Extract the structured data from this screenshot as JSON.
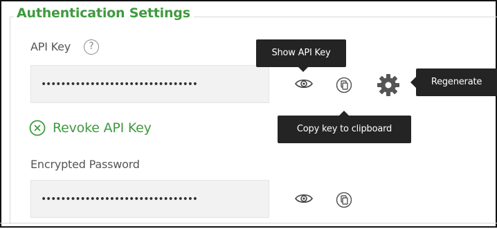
{
  "section": {
    "legend": "Authentication Settings"
  },
  "api_key": {
    "label": "API Key",
    "help_icon": "?",
    "masked_value": "••••••••••••••••••••••••••••••••",
    "show_tooltip": "Show API Key",
    "copy_tooltip": "Copy key to clipboard",
    "regenerate_tooltip": "Regenerate"
  },
  "revoke": {
    "label": "Revoke API Key",
    "icon": "circle-x-icon"
  },
  "password": {
    "label": "Encrypted Password",
    "masked_value": "••••••••••••••••••••••••••••••••"
  },
  "colors": {
    "accent": "#3f9a3f",
    "tooltip_bg": "#242424",
    "field_bg": "#f2f2f2"
  }
}
